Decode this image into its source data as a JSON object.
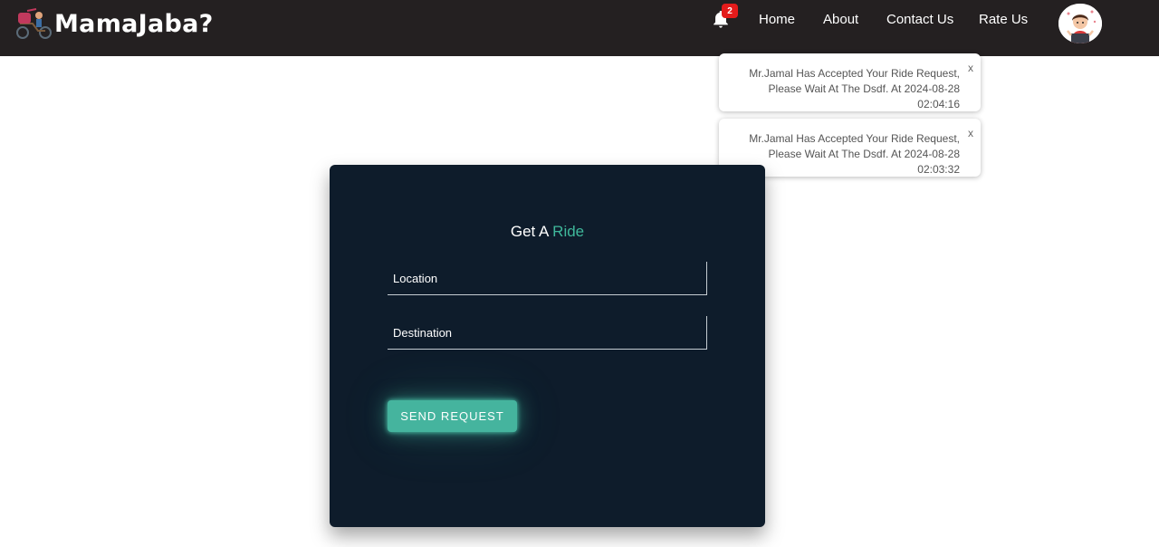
{
  "brand": {
    "name": "MamaJaba?",
    "logo_icon": "rickshaw-logo-icon"
  },
  "nav": {
    "notification_count": "2",
    "bell_icon": "bell-icon",
    "links": [
      "Home",
      "About",
      "Contact Us",
      "Rate Us"
    ],
    "avatar_icon": "user-avatar-icon"
  },
  "notifications": [
    {
      "text": "Mr.Jamal Has Accepted Your Ride Request, Please Wait At The Dsdf. At 2024-08-28 02:04:16",
      "close": "x"
    },
    {
      "text": "Mr.Jamal Has Accepted Your Ride Request, Please Wait At The Dsdf. At 2024-08-28 02:03:32",
      "close": "x"
    }
  ],
  "ride_form": {
    "title_prefix": "Get A",
    "title_accent": "Ride",
    "location_placeholder": "Location",
    "destination_placeholder": "Destination",
    "submit_label": "SEND REQUEST"
  },
  "colors": {
    "navbar_bg": "#242021",
    "card_bg": "#0e1c2b",
    "accent": "#3fb89b",
    "button_bg": "#45b49e",
    "badge_bg": "#e41b1b"
  }
}
